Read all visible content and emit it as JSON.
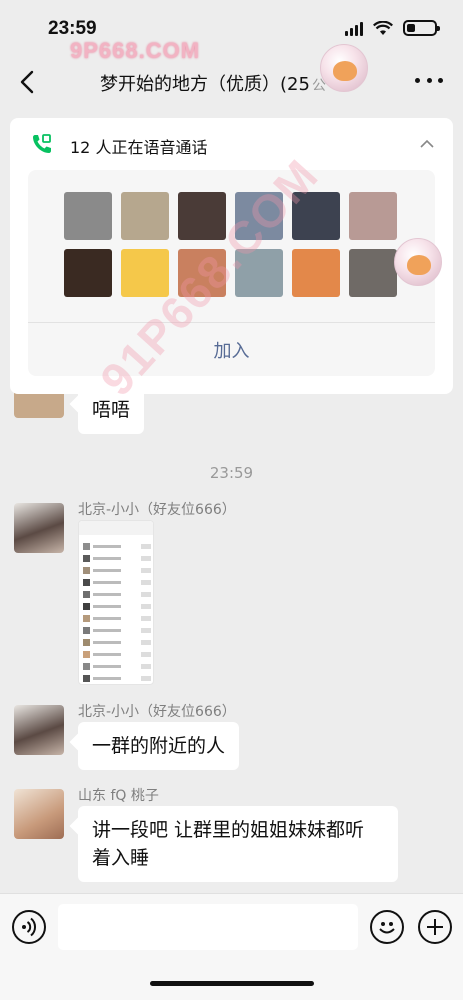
{
  "status_bar": {
    "time": "23:59"
  },
  "watermark": {
    "logo_text": "9P668.COM",
    "diagonal_text": "91P668.COM"
  },
  "nav": {
    "title": "梦开始的地方（优质）(25",
    "title_suffix": "公"
  },
  "voice_call": {
    "status_text": "12 人正在语音通话",
    "join_label": "加入",
    "members": [
      {
        "color": "#8a8a8a"
      },
      {
        "color": "#b6a78e"
      },
      {
        "color": "#4a3b37"
      },
      {
        "color": "#7c8aa0"
      },
      {
        "color": "#3d4250"
      },
      {
        "color": "#b89a95"
      },
      {
        "color": "#3a2a22"
      },
      {
        "color": "#f5c84a"
      },
      {
        "color": "#c9805f"
      },
      {
        "color": "#8fa0a8"
      },
      {
        "color": "#e3884a"
      },
      {
        "color": "#6f6a66"
      }
    ]
  },
  "messages": [
    {
      "type": "text",
      "text": "唔唔"
    },
    {
      "type": "time",
      "text": "23:59"
    },
    {
      "type": "image",
      "sender": "北京-小小（好友位666）"
    },
    {
      "type": "text",
      "sender": "北京-小小（好友位666）",
      "text": "一群的附近的人"
    },
    {
      "type": "text",
      "sender": "山东 fQ 桃子",
      "text_line1": "讲一段吧 让群里的姐姐妹妹都听",
      "text_line2": "着入睡"
    }
  ],
  "colors": {
    "accent_link": "#576b95",
    "call_green": "#07c160",
    "background": "#ededed"
  }
}
